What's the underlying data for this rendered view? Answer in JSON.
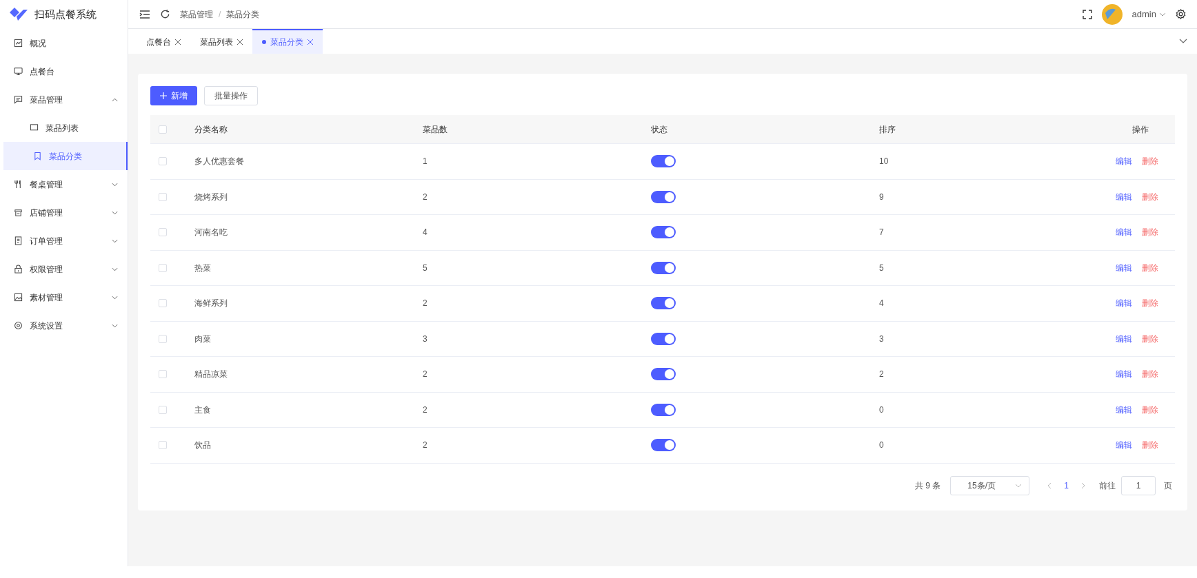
{
  "app": {
    "title": "扫码点餐系统"
  },
  "sidebar": {
    "items": [
      {
        "label": "概况",
        "selected": false
      },
      {
        "label": "点餐台",
        "selected": false
      },
      {
        "label": "菜品管理",
        "selected": false,
        "expanded": true,
        "children": [
          {
            "label": "菜品列表",
            "selected": false
          },
          {
            "label": "菜品分类",
            "selected": true
          }
        ]
      },
      {
        "label": "餐桌管理",
        "selected": false,
        "expanded": false
      },
      {
        "label": "店铺管理",
        "selected": false,
        "expanded": false
      },
      {
        "label": "订单管理",
        "selected": false,
        "expanded": false
      },
      {
        "label": "权限管理",
        "selected": false,
        "expanded": false
      },
      {
        "label": "素材管理",
        "selected": false,
        "expanded": false
      },
      {
        "label": "系统设置",
        "selected": false,
        "expanded": false
      }
    ]
  },
  "breadcrumb": {
    "items": [
      "菜品管理",
      "菜品分类"
    ],
    "separator": "/"
  },
  "user": {
    "name": "admin"
  },
  "tabs": [
    {
      "label": "点餐台",
      "selected": false
    },
    {
      "label": "菜品列表",
      "selected": false
    },
    {
      "label": "菜品分类",
      "selected": true
    }
  ],
  "toolbar": {
    "add": "新增",
    "batch": "批量操作"
  },
  "table": {
    "columns": [
      "分类名称",
      "菜品数",
      "状态",
      "排序",
      "操作"
    ],
    "all_checked": false,
    "rows": [
      {
        "name": "多人优惠套餐",
        "count": "1",
        "on": true,
        "sort": "10",
        "checked": false,
        "edit": "编辑",
        "delete": "删除"
      },
      {
        "name": "烧烤系列",
        "count": "2",
        "on": true,
        "sort": "9",
        "checked": false,
        "edit": "编辑",
        "delete": "删除"
      },
      {
        "name": "河南名吃",
        "count": "4",
        "on": true,
        "sort": "7",
        "checked": false,
        "edit": "编辑",
        "delete": "删除"
      },
      {
        "name": "热菜",
        "count": "5",
        "on": true,
        "sort": "5",
        "checked": false,
        "edit": "编辑",
        "delete": "删除"
      },
      {
        "name": "海鲜系列",
        "count": "2",
        "on": true,
        "sort": "4",
        "checked": false,
        "edit": "编辑",
        "delete": "删除"
      },
      {
        "name": "肉菜",
        "count": "3",
        "on": true,
        "sort": "3",
        "checked": false,
        "edit": "编辑",
        "delete": "删除"
      },
      {
        "name": "精品凉菜",
        "count": "2",
        "on": true,
        "sort": "2",
        "checked": false,
        "edit": "编辑",
        "delete": "删除"
      },
      {
        "name": "主食",
        "count": "2",
        "on": true,
        "sort": "0",
        "checked": false,
        "edit": "编辑",
        "delete": "删除"
      },
      {
        "name": "饮品",
        "count": "2",
        "on": true,
        "sort": "0",
        "checked": false,
        "edit": "编辑",
        "delete": "删除"
      }
    ]
  },
  "pagination": {
    "total": "共 9 条",
    "page_size": "15条/页",
    "pages": [
      {
        "label": "1",
        "selected": true
      }
    ],
    "goto": "前往",
    "goto_value": "1",
    "page_unit": "页"
  }
}
